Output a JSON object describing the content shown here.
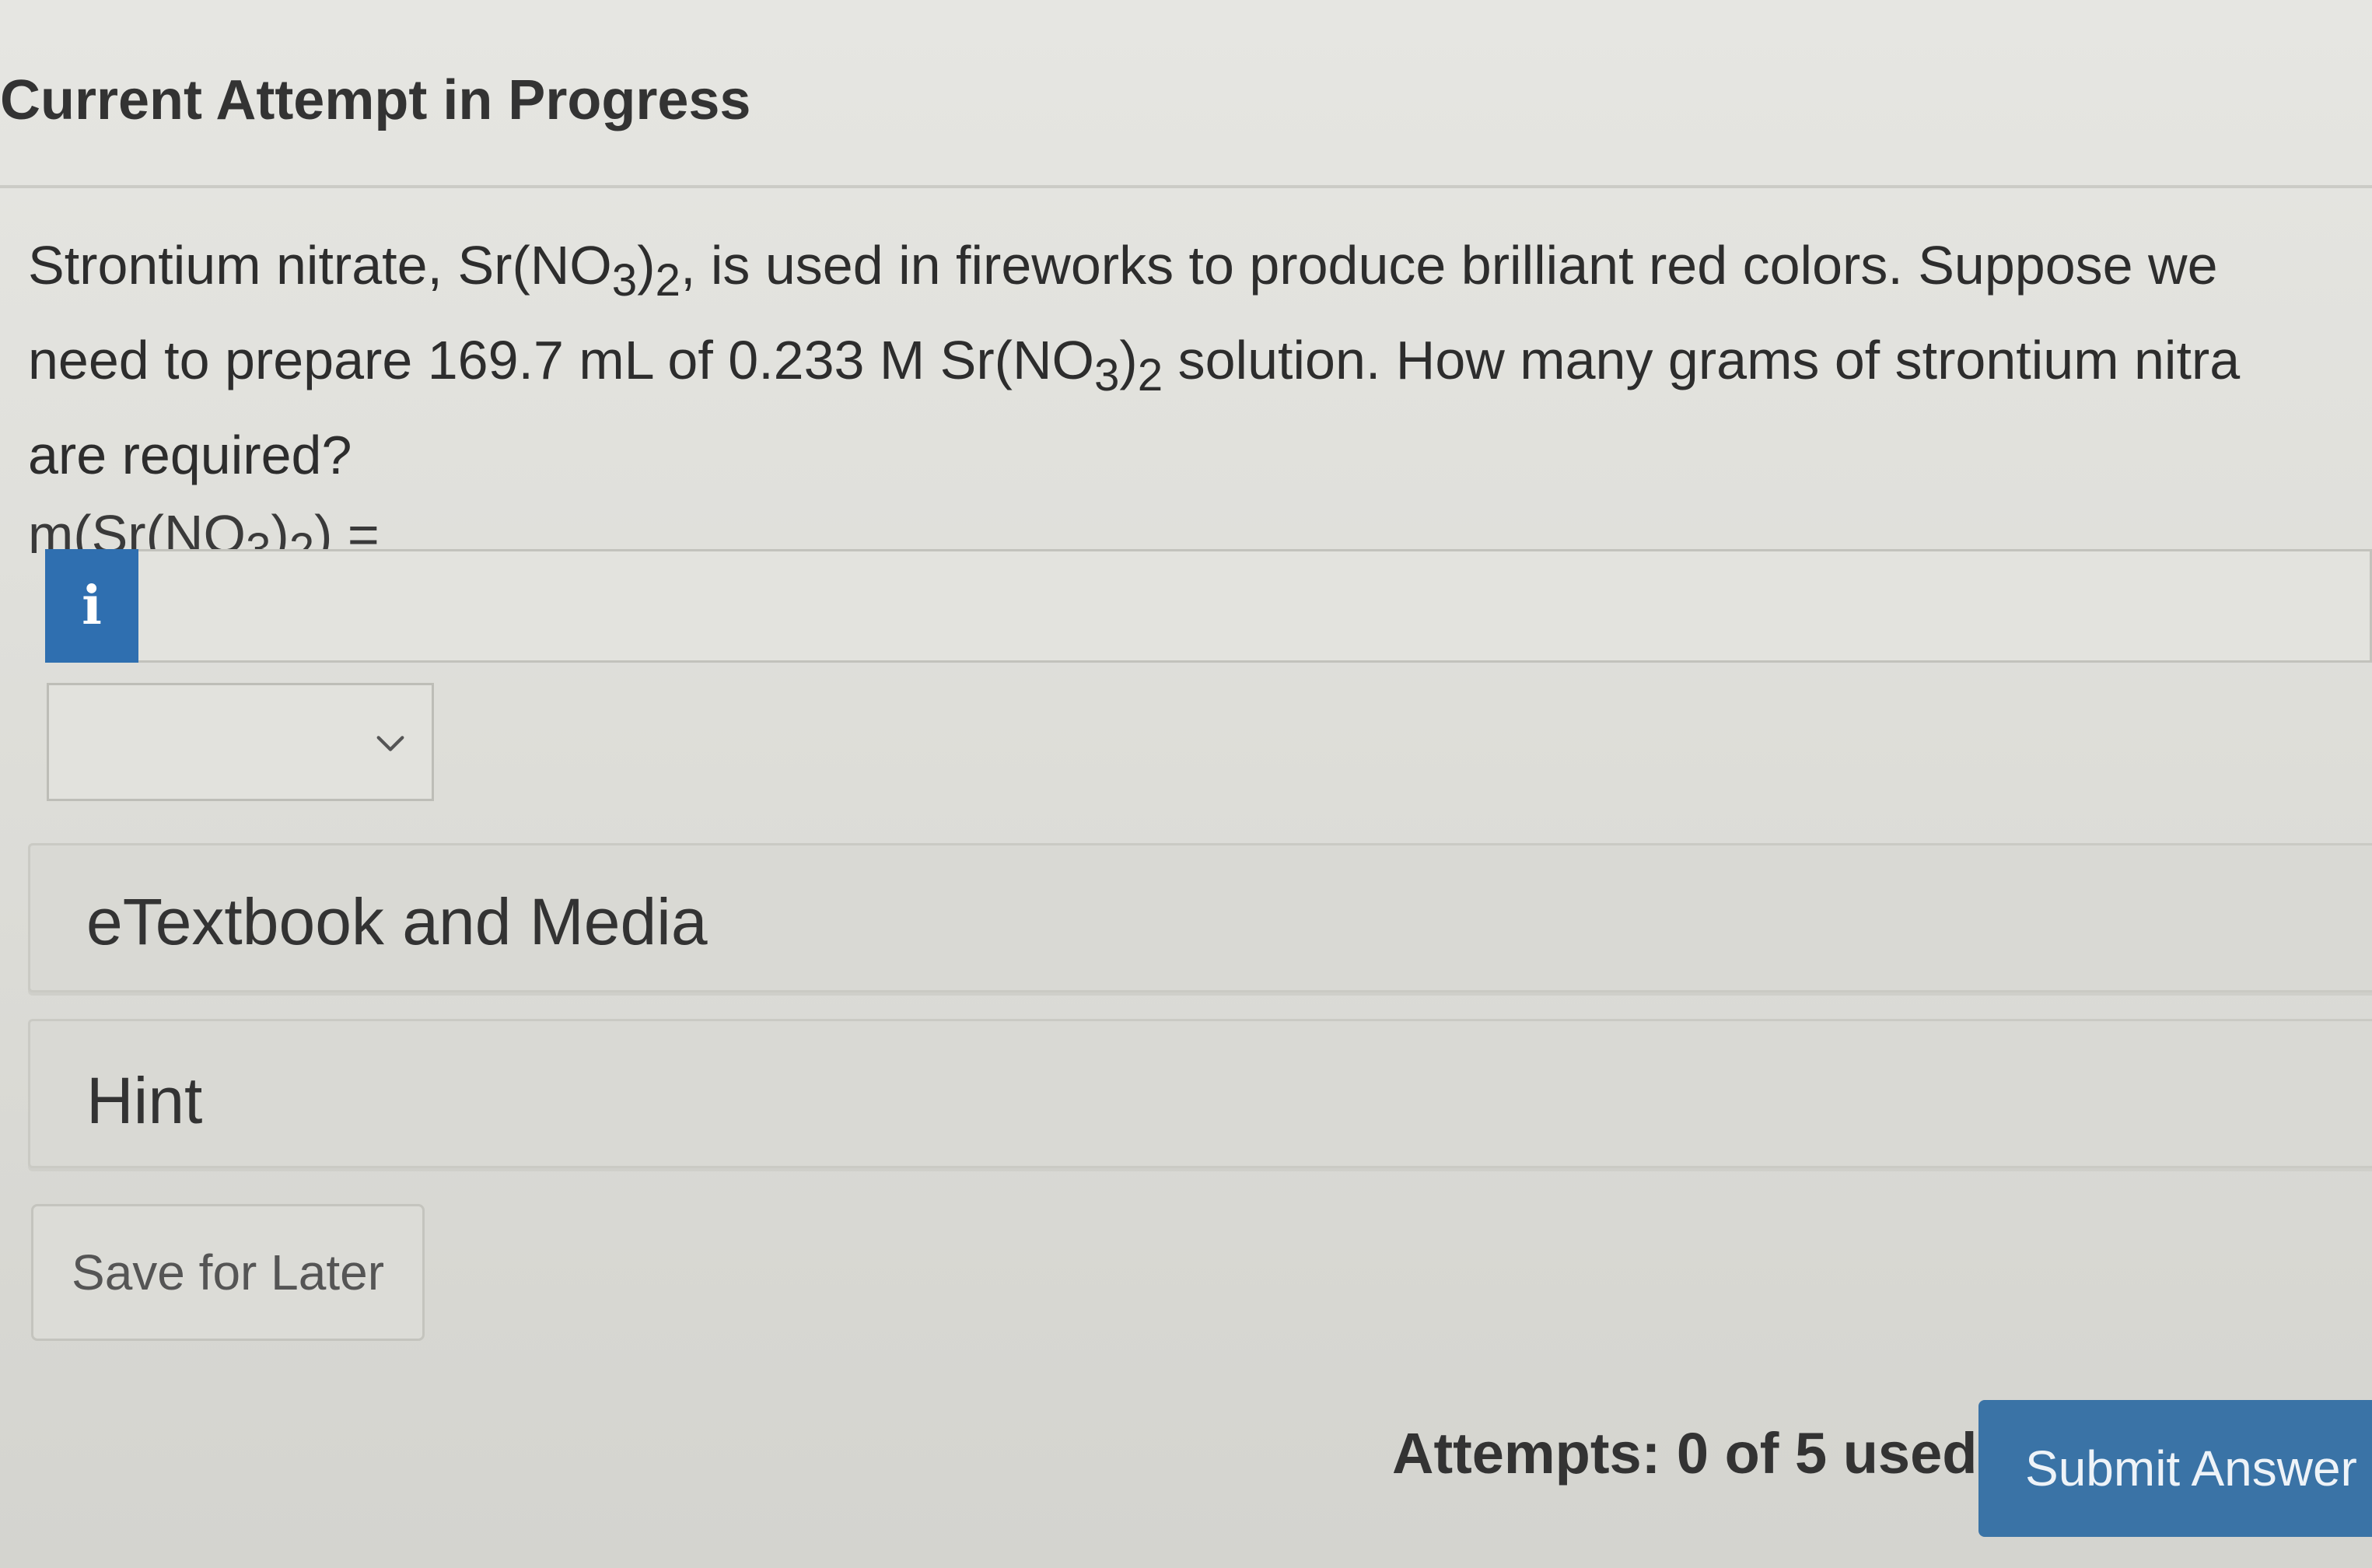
{
  "header": {
    "title": "Current Attempt in Progress"
  },
  "question": {
    "line1_a": "Strontium nitrate, Sr(NO",
    "line1_sub1": "3",
    "line1_b": ")",
    "line1_sub2": "2",
    "line1_c": ", is used in fireworks to produce brilliant red colors. Suppose we",
    "line2_a": "need to prepare 169.7 mL of 0.233 M Sr(NO",
    "line2_sub1": "3",
    "line2_b": ")",
    "line2_sub2": "2",
    "line2_c": " solution. How many grams of strontium nitra",
    "line3": "are required?",
    "formula_a": "m(Sr(NO",
    "formula_sub1": "3",
    "formula_b": ")",
    "formula_sub2": "2",
    "formula_c": ") ="
  },
  "answer": {
    "info_icon_glyph": "i",
    "value": "",
    "unit_value": ""
  },
  "panels": {
    "etextbook_label": "eTextbook and Media",
    "hint_label": "Hint"
  },
  "actions": {
    "save_label": "Save for Later",
    "attempts_text": "Attempts: 0 of 5 used",
    "submit_label": "Submit Answer"
  },
  "colors": {
    "accent": "#3a73a6",
    "info_badge": "#2f6fb0"
  }
}
